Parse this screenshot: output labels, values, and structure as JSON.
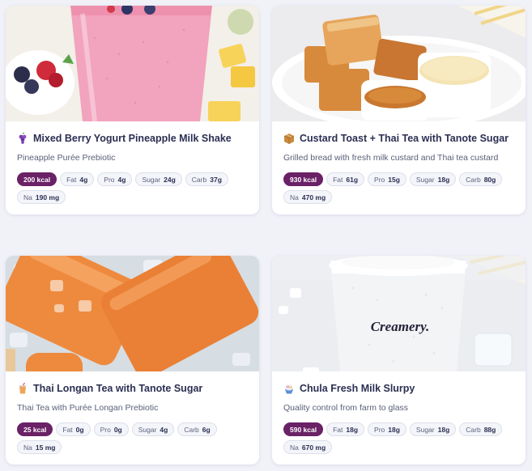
{
  "colors": {
    "kcal_chip": "#6a2166",
    "title_text": "#2b2f52",
    "subtitle_text": "#5b6078",
    "page_bg": "#f1f2f8"
  },
  "cards": [
    {
      "icon": "grapes-icon",
      "title": "Mixed Berry Yogurt Pineapple Milk Shake",
      "subtitle": "Pineapple Purée Prebiotic",
      "kcal": "200 kcal",
      "fat_label": "Fat",
      "fat": "4g",
      "pro_label": "Pro",
      "pro": "4g",
      "sugar_label": "Sugar",
      "sugar": "24g",
      "carb_label": "Carb",
      "carb": "37g",
      "na_label": "Na",
      "na": "190 mg"
    },
    {
      "icon": "box-icon",
      "title": "Custard Toast + Thai Tea with Tanote Sugar",
      "subtitle": "Grilled bread with fresh milk custard and Thai tea custard",
      "kcal": "930 kcal",
      "fat_label": "Fat",
      "fat": "61g",
      "pro_label": "Pro",
      "pro": "15g",
      "sugar_label": "Sugar",
      "sugar": "18g",
      "carb_label": "Carb",
      "carb": "80g",
      "na_label": "Na",
      "na": "470 mg"
    },
    {
      "icon": "cup-with-straw-icon",
      "title": "Thai Longan Tea with Tanote Sugar",
      "subtitle": "Thai Tea with Purée Longan Prebiotic",
      "kcal": "25 kcal",
      "fat_label": "Fat",
      "fat": "0g",
      "pro_label": "Pro",
      "pro": "0g",
      "sugar_label": "Sugar",
      "sugar": "4g",
      "carb_label": "Carb",
      "carb": "6g",
      "na_label": "Na",
      "na": "15 mg"
    },
    {
      "icon": "shaved-ice-icon",
      "title": "Chula Fresh Milk Slurpy",
      "subtitle": "Quality control from farm to glass",
      "kcal": "590 kcal",
      "fat_label": "Fat",
      "fat": "18g",
      "pro_label": "Pro",
      "pro": "18g",
      "sugar_label": "Sugar",
      "sugar": "18g",
      "carb_label": "Carb",
      "carb": "88g",
      "na_label": "Na",
      "na": "670 mg",
      "cup_print": "Creamery."
    }
  ]
}
